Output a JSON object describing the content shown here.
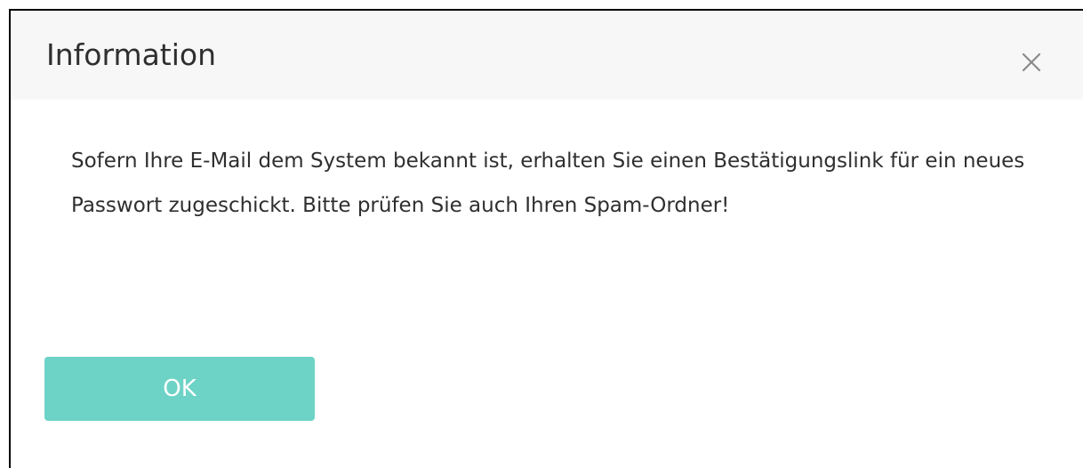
{
  "dialog": {
    "title": "Information",
    "close_icon": "close-icon",
    "message": "Sofern Ihre E-Mail dem System bekannt ist, erhalten Sie einen Bestätigungslink für ein neues Passwort zugeschickt. Bitte prüfen Sie auch Ihren Spam-Ordner!",
    "ok_label": "OK"
  },
  "colors": {
    "header_background": "#f7f7f7",
    "ok_button": "#6dd3c6",
    "close_icon": "#8a8a8a",
    "text": "#2f2f2f"
  }
}
